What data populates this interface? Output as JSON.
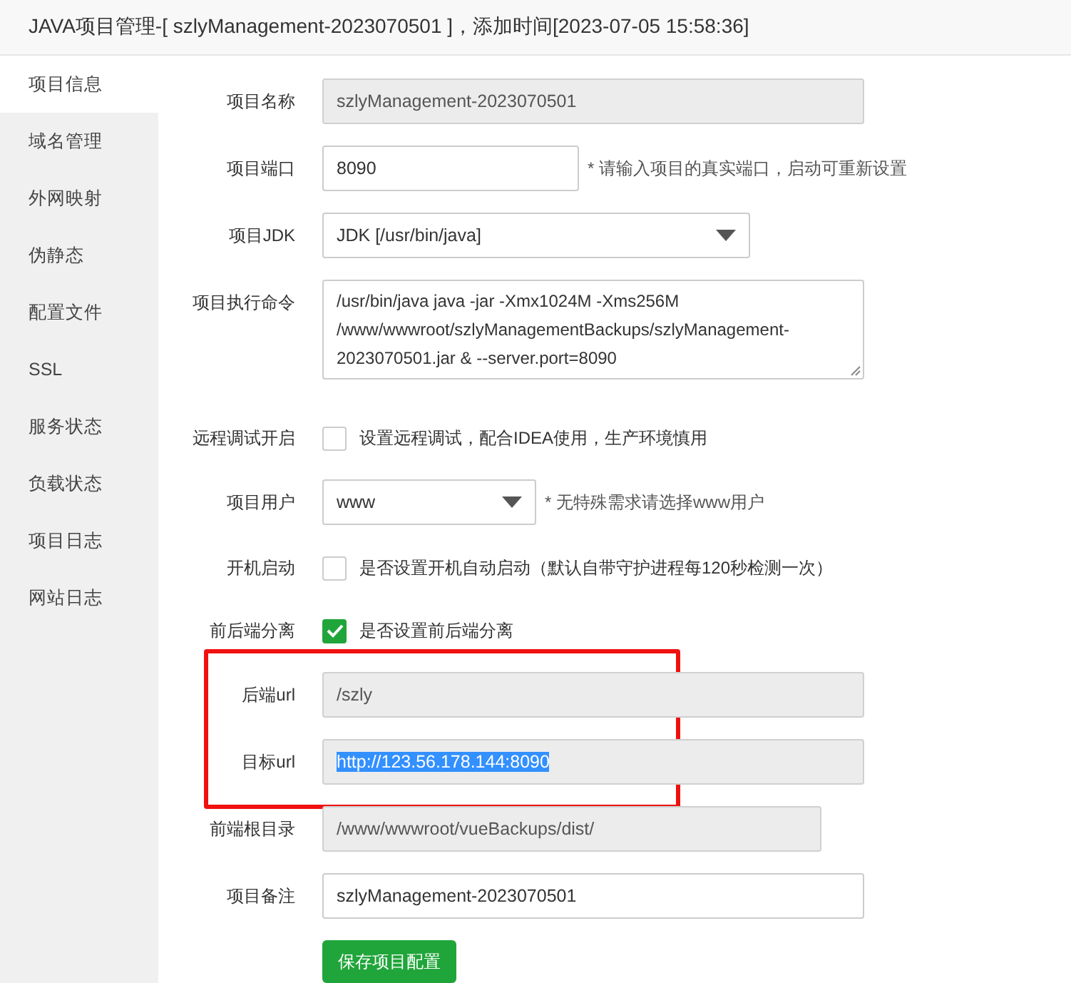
{
  "window": {
    "title": "JAVA项目管理-[ szlyManagement-2023070501 ]，添加时间[2023-07-05 15:58:36]"
  },
  "sidebar": {
    "items": [
      {
        "label": "项目信息",
        "selected": true
      },
      {
        "label": "域名管理",
        "selected": false
      },
      {
        "label": "外网映射",
        "selected": false
      },
      {
        "label": "伪静态",
        "selected": false
      },
      {
        "label": "配置文件",
        "selected": false
      },
      {
        "label": "SSL",
        "selected": false
      },
      {
        "label": "服务状态",
        "selected": false
      },
      {
        "label": "负载状态",
        "selected": false
      },
      {
        "label": "项目日志",
        "selected": false
      },
      {
        "label": "网站日志",
        "selected": false
      }
    ]
  },
  "form": {
    "rows": [
      {
        "kind": "input",
        "label": "项目名称",
        "value": "szlyManagement-2023070501",
        "disabled": true
      },
      {
        "kind": "input",
        "label": "项目端口",
        "value": "8090",
        "disabled": false,
        "hint": "* 请输入项目的真实端口，启动可重新设置"
      },
      {
        "kind": "select",
        "label": "项目JDK",
        "value": "JDK [/usr/bin/java]"
      },
      {
        "kind": "textarea",
        "label": "项目执行命令",
        "value": "/usr/bin/java java -jar -Xmx1024M -Xms256M /www/wwwroot/szlyManagementBackups/szlyManagement-2023070501.jar & --server.port=8090"
      },
      {
        "kind": "checkbox",
        "label": "远程调试开启",
        "checked": false,
        "text": "设置远程调试，配合IDEA使用，生产环境慎用"
      },
      {
        "kind": "select",
        "label": "项目用户",
        "value": "www",
        "hint": "* 无特殊需求请选择www用户"
      },
      {
        "kind": "checkbox",
        "label": "开机启动",
        "checked": false,
        "text": "是否设置开机自动启动（默认自带守护进程每120秒检测一次）"
      },
      {
        "kind": "checkbox",
        "label": "前后端分离",
        "checked": true,
        "text": "是否设置前后端分离"
      },
      {
        "kind": "group",
        "outlined": true,
        "rows": [
          {
            "kind": "input",
            "label": "后端url",
            "value": "/szly",
            "disabled": true
          },
          {
            "kind": "input",
            "label": "目标url",
            "value": "http://123.56.178.144:8090",
            "disabled": true,
            "text_selected": true
          }
        ]
      },
      {
        "kind": "input",
        "label": "前端根目录",
        "value": "/www/wwwroot/vueBackups/dist/",
        "disabled": true
      },
      {
        "kind": "input",
        "label": "项目备注",
        "value": "szlyManagement-2023070501",
        "disabled": false
      }
    ]
  },
  "buttons": [
    {
      "label": "保存项目配置"
    }
  ]
}
